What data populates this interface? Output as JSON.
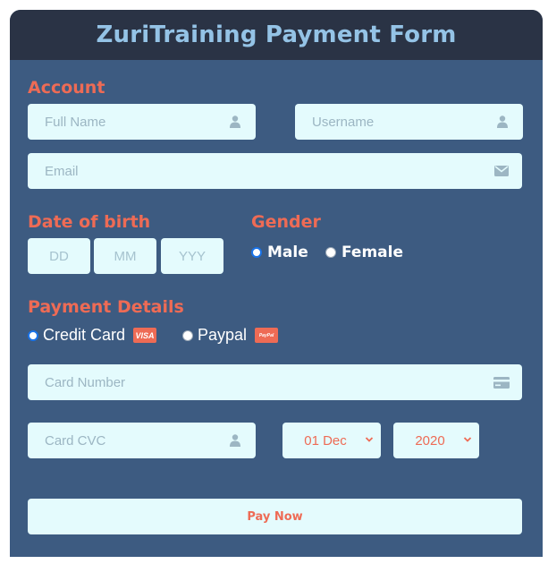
{
  "header": {
    "title": "ZuriTraining Payment Form"
  },
  "account": {
    "title": "Account",
    "full_name": {
      "placeholder": "Full Name",
      "icon": "user-icon"
    },
    "username": {
      "placeholder": "Username",
      "icon": "user-icon"
    },
    "email": {
      "placeholder": "Email",
      "icon": "envelope-icon"
    }
  },
  "dob": {
    "title": "Date of birth",
    "day_placeholder": "DD",
    "month_placeholder": "MM",
    "year_placeholder": "YYY"
  },
  "gender": {
    "title": "Gender",
    "options": [
      {
        "label": "Male",
        "checked": true
      },
      {
        "label": "Female",
        "checked": false
      }
    ]
  },
  "payment": {
    "title": "Payment Details",
    "methods": [
      {
        "label": "Credit Card",
        "badge": "VISA",
        "checked": true
      },
      {
        "label": "Paypal",
        "badge": "PayPal",
        "checked": false
      }
    ],
    "card_number": {
      "placeholder": "Card Number",
      "icon": "credit-card-icon"
    },
    "card_cvc": {
      "placeholder": "Card CVC",
      "icon": "user-icon"
    },
    "expiry_select": "01 Dec",
    "year_select": "2020",
    "submit_label": "Pay Now"
  },
  "colors": {
    "background": "#3d5b81",
    "header": "#2a3345",
    "title": "#94c3e6",
    "accent": "#ee6b55",
    "field": "#e4fbfd",
    "icon": "#9cb6c3"
  }
}
